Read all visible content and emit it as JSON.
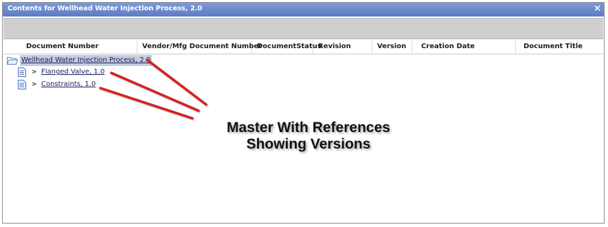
{
  "window": {
    "title": "Contents for Wellhead Water Injection Process, 2.0",
    "close_glyph": "×"
  },
  "table": {
    "columns": [
      "Document Number",
      "Vendor/Mfg Document Number",
      "DocumentStatus",
      "Revision",
      "Version",
      "Creation Date",
      "Document Title"
    ]
  },
  "tree": {
    "root": {
      "label": "Wellhead Water Injection Process, 2.0",
      "icon": "folder-icon"
    },
    "children": [
      {
        "label": "Flanged Valve, 1.0",
        "icon": "document-icon",
        "expander": ">"
      },
      {
        "label": "Constraints, 1.0",
        "icon": "document-icon",
        "expander": ">"
      }
    ]
  },
  "annotation": {
    "line1": "Master With References",
    "line2": "Showing Versions",
    "arrow_color": "#d42020"
  }
}
